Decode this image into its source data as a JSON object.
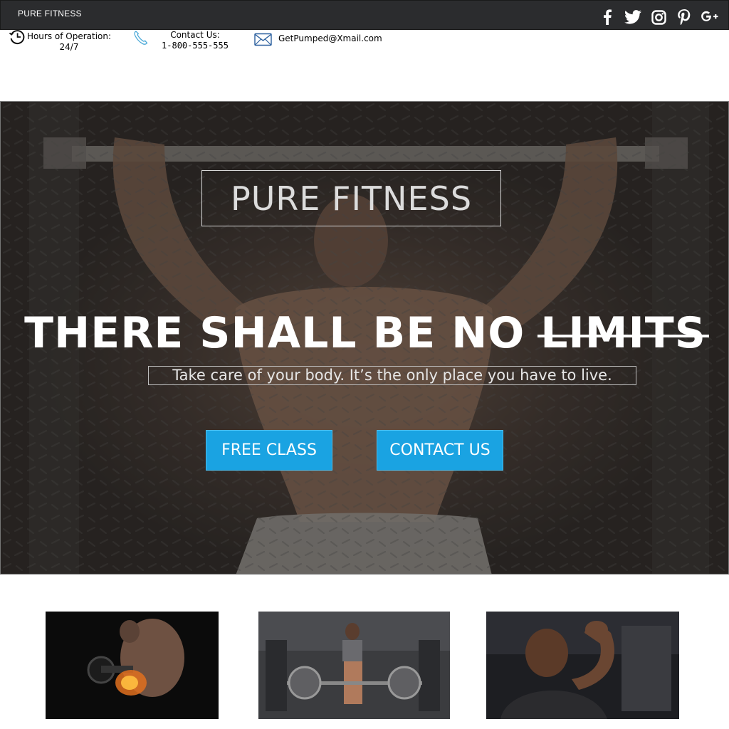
{
  "topbar": {
    "brand": "PURE FITNESS",
    "social": [
      {
        "icon": "facebook-icon"
      },
      {
        "icon": "twitter-icon"
      },
      {
        "icon": "instagram-icon"
      },
      {
        "icon": "pinterest-icon"
      },
      {
        "icon": "google-plus-icon"
      }
    ]
  },
  "info": {
    "hours_label": "Hours of Operation:",
    "hours_value": "24/7",
    "contact_label": "Contact Us:",
    "contact_value": "1-800-555-555",
    "email": "GetPumped@Xmail.com"
  },
  "hero": {
    "title": "PURE FITNESS",
    "headline_main": "THERE SHALL BE NO ",
    "headline_struck": "LIMITS",
    "tagline": "Take care of your body. It’s the only place you have to live.",
    "buttons": {
      "free_class": "FREE CLASS",
      "contact_us": "CONTACT US"
    }
  },
  "colors": {
    "topbar": "#2b2c2e",
    "accent": "#1aa3e2",
    "hero_overlay": "#2f2c2a"
  }
}
